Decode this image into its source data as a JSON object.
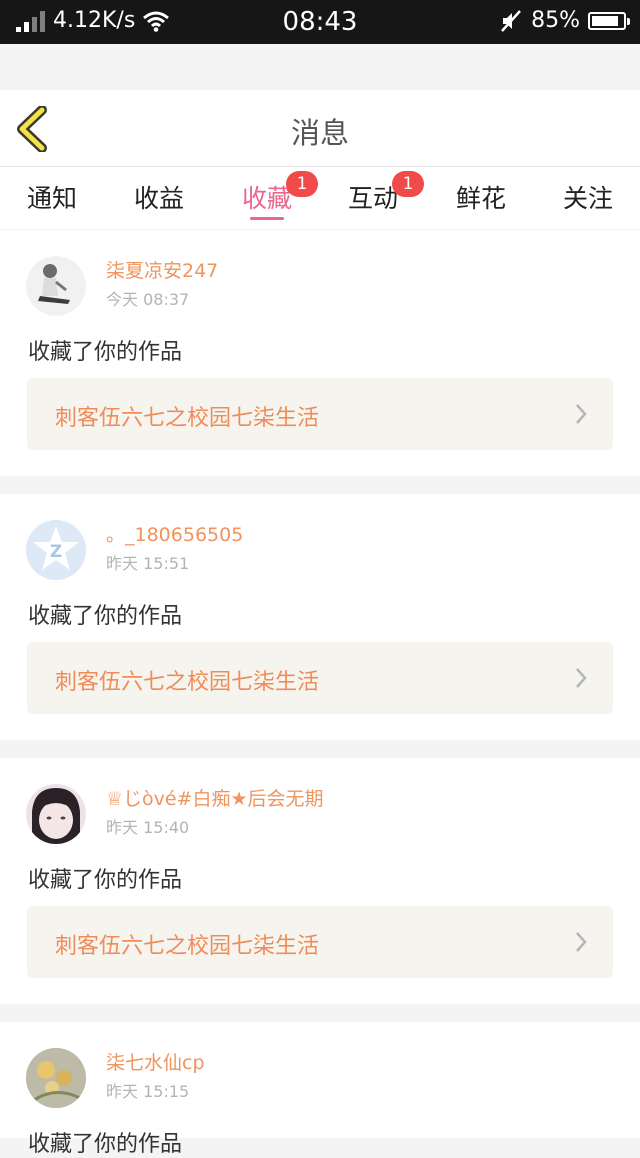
{
  "status_bar": {
    "speed": "4.12K/s",
    "time": "08:43",
    "battery": "85%",
    "battery_level": 0.85
  },
  "navbar": {
    "title": "消息"
  },
  "tabs": [
    {
      "label": "通知"
    },
    {
      "label": "收益"
    },
    {
      "label": "收藏",
      "active": true,
      "badge": "1"
    },
    {
      "label": "互动",
      "badge": "1"
    },
    {
      "label": "鲜花"
    },
    {
      "label": "关注"
    }
  ],
  "feed": [
    {
      "user": "柒夏凉安247",
      "time": "今天 08:37",
      "action": "收藏了你的作品",
      "work": "刺客伍六七之校园七柒生活"
    },
    {
      "user": "。_180656505",
      "time": "昨天 15:51",
      "action": "收藏了你的作品",
      "work": "刺客伍六七之校园七柒生活"
    },
    {
      "user": "♕じòvé#白痴★后会无期",
      "time": "昨天 15:40",
      "action": "收藏了你的作品",
      "work": "刺客伍六七之校园七柒生活"
    },
    {
      "user": "柒七水仙cp",
      "time": "昨天 15:15",
      "action": "收藏了你的作品",
      "work": ""
    }
  ],
  "colors": {
    "accent": "#e9678f",
    "username": "#f0945e",
    "badge": "#f04a4a"
  }
}
